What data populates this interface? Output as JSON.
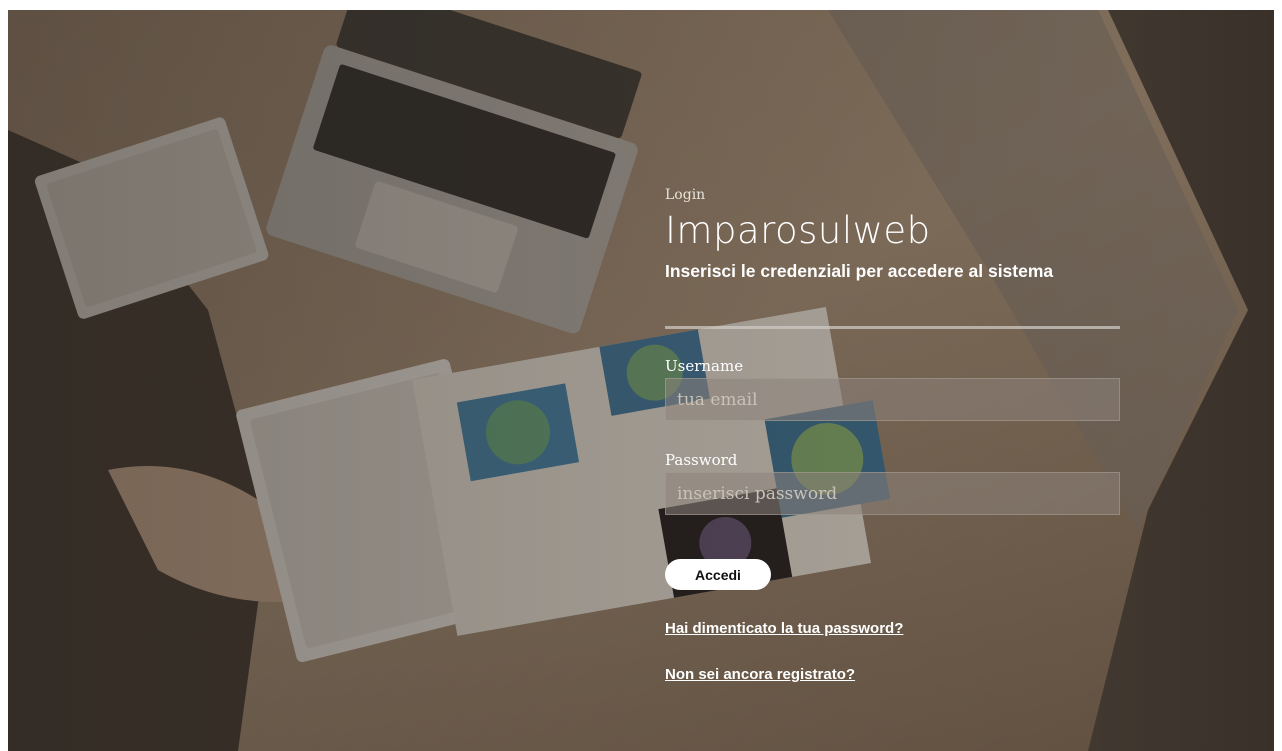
{
  "login": {
    "eyebrow": "Login",
    "app_name": "Imparosulweb",
    "subtitle": "Inserisci le credenziali per accedere al sistema",
    "username_label": "Username",
    "username_placeholder": "tua email",
    "username_value": "",
    "password_label": "Password",
    "password_placeholder": "inserisci password",
    "password_value": "",
    "submit_label": "Accedi",
    "forgot_link": "Hai dimenticato la tua password?",
    "register_link": "Non sei ancora registrato?"
  },
  "colors": {
    "text": "#ffffff",
    "button_bg": "#ffffff",
    "input_bg": "#8c827a",
    "divider": "#cdc8c3"
  },
  "background": {
    "image_subject": "desk-with-laptops-keyboards-and-printed-reports"
  }
}
